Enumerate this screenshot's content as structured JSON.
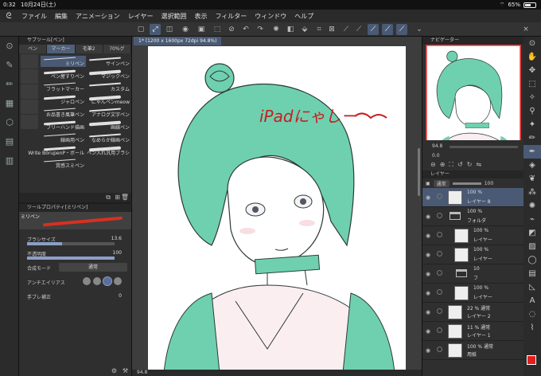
{
  "status": {
    "time": "0:32",
    "date": "10月24日(土)",
    "battery": "65%",
    "battery_level": 0.65
  },
  "menu": [
    "ファイル",
    "編集",
    "アニメーション",
    "レイヤー",
    "選択範囲",
    "表示",
    "フィルター",
    "ウィンドウ",
    "ヘルプ"
  ],
  "subtool": {
    "title": "サブツール[ペン]",
    "tabs": [
      "ペン",
      "マーカー",
      "毛筆2",
      "70%グ"
    ],
    "selected_tab": 1,
    "brushes": [
      "ミリペン",
      "サインペン",
      "ペン屋すりペン",
      "マジックペン",
      "フラットマーカー",
      "カスタム",
      "ジャロペン",
      "にゃんペンmeow",
      "お品書き風筆ペン",
      "アナログ文字ペン",
      "フリーハンド描画",
      "画線ペン",
      "線画用ペン",
      "なめらか線画ペン",
      "Write BörupenP・ボール",
      "ペン入れ汎用ブラシ",
      "質感スミペン"
    ],
    "selected_brush": 0
  },
  "toolprop": {
    "title": "ツールプロパティ[ミリペン]",
    "brush_name": "ミリペン",
    "size_label": "ブラシサイズ",
    "size_value": "13.6",
    "size_fraction": 0.4,
    "opacity_label": "不透明度",
    "opacity_value": "100",
    "opacity_fraction": 1.0,
    "blend_label": "合成モード",
    "blend_value": "通常",
    "aa_label": "アンチエイリアス",
    "stab_label": "手ブレ補正",
    "stab_value": "0"
  },
  "canvas": {
    "tab": "1* (1200 x 1600px 72dpi 94.8%)",
    "zoom_footer": "94.8",
    "annotation": "iPadにゃしー"
  },
  "navigator": {
    "title": "ナビゲーター",
    "zoom": "94.8",
    "rotation": "0.0"
  },
  "layers": {
    "title": "レイヤー",
    "blend": "通常",
    "opacity": "100",
    "rows": [
      {
        "pct": "100 %",
        "name": "レイヤー 8",
        "kind": "layer",
        "selected": true
      },
      {
        "pct": "100 %",
        "name": "フォルダ",
        "kind": "folder",
        "selected": false
      },
      {
        "pct": "100 %",
        "name": "レイヤー",
        "kind": "layer",
        "selected": false
      },
      {
        "pct": "100 %",
        "name": "レイヤー",
        "kind": "layer",
        "selected": false
      },
      {
        "pct": "10",
        "name": "フ",
        "kind": "folder",
        "selected": false
      },
      {
        "pct": "100 %",
        "name": "レイヤー",
        "kind": "layer",
        "selected": false
      },
      {
        "pct": "22 % 通常",
        "name": "レイヤー 2",
        "kind": "layer",
        "selected": false
      },
      {
        "pct": "11 % 通常",
        "name": "レイヤー 1",
        "kind": "layer",
        "selected": false
      },
      {
        "pct": "100 % 通常",
        "name": "用紙",
        "kind": "layer",
        "selected": false
      }
    ]
  },
  "colors": {
    "accent": "#4a5a74",
    "main_color": "#e02020",
    "hair": "#6fd0b0"
  }
}
